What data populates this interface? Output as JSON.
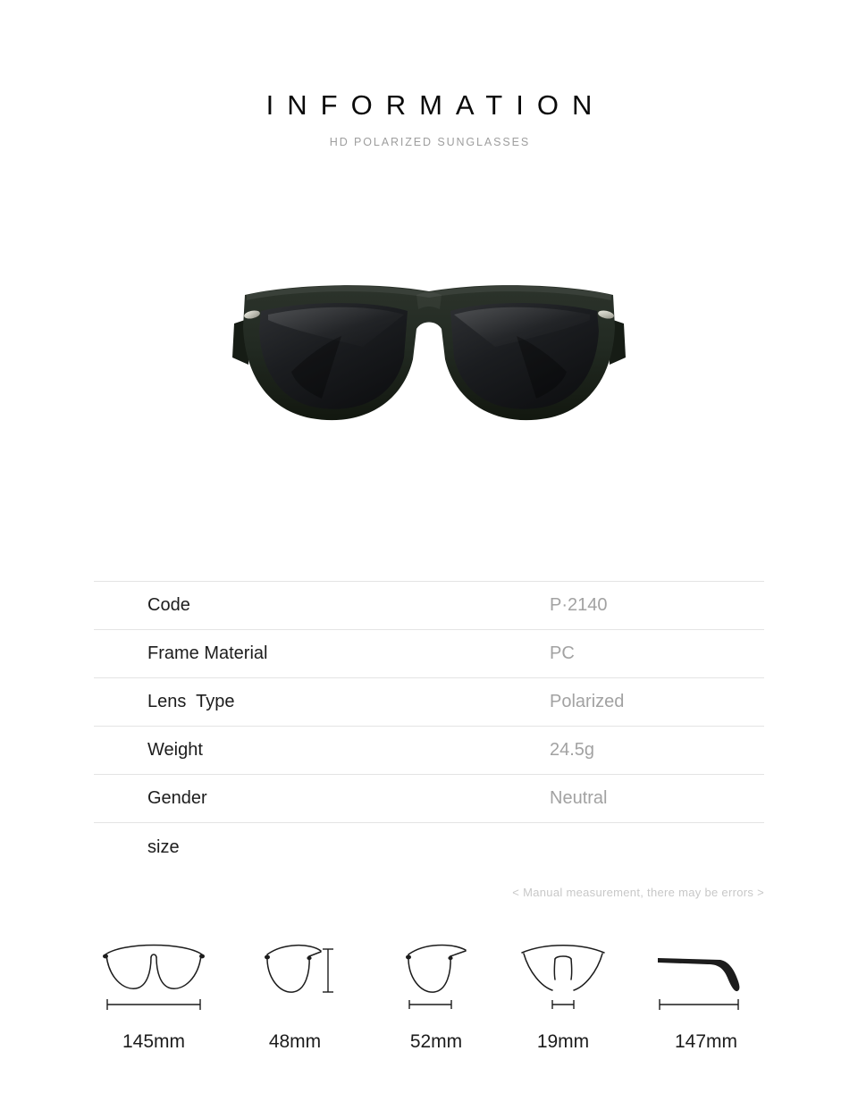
{
  "header": {
    "title": "INFORMATION",
    "subtitle": "HD POLARIZED SUNGLASSES"
  },
  "product_photo": {
    "alt": "black polarized wayfarer sunglasses front view",
    "frame_color": "#1f2620",
    "lens_color": "#16181a",
    "rivet_color": "#cfcfc6"
  },
  "specs": {
    "rows": [
      {
        "label": "Code",
        "value": "P·2140"
      },
      {
        "label": "Frame Material",
        "value": "PC"
      },
      {
        "label": "Lens  Type",
        "value": "Polarized"
      },
      {
        "label": "Weight",
        "value": "24.5g"
      },
      {
        "label": "Gender",
        "value": "Neutral"
      }
    ],
    "size_heading": "size"
  },
  "disclaimer": "< Manual measurement, there may be errors >",
  "size_diagrams": {
    "items": [
      {
        "icon": "full-frame-front-icon",
        "measure": "145mm",
        "dimension": "horizontal"
      },
      {
        "icon": "lens-height-icon",
        "measure": "48mm",
        "dimension": "vertical"
      },
      {
        "icon": "lens-width-icon",
        "measure": "52mm",
        "dimension": "horizontal"
      },
      {
        "icon": "bridge-width-icon",
        "measure": "19mm",
        "dimension": "horizontal"
      },
      {
        "icon": "temple-arm-length-icon",
        "measure": "147mm",
        "dimension": "horizontal"
      }
    ]
  },
  "colors": {
    "background": "#ffffff",
    "title_text": "#0a0a0a",
    "subtitle_text": "#9e9e9e",
    "label_text": "#1c1c1c",
    "value_text": "#a2a2a2",
    "rule": "#e4e4e4",
    "disclaimer_text": "#c8c8c8"
  }
}
